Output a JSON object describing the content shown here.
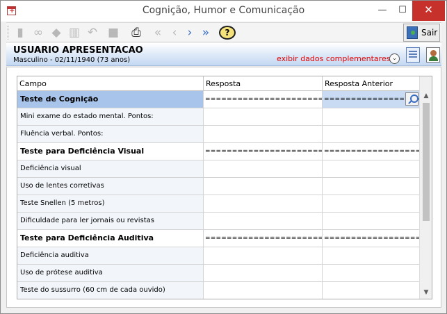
{
  "window": {
    "title": "Cognição, Humor e Comunicação",
    "minimize_glyph": "—",
    "maximize_glyph": "☐",
    "close_glyph": "✕"
  },
  "toolbar": {
    "help_label": "?",
    "exit_label": "Sair",
    "icons": [
      "new-icon",
      "binoculars-icon",
      "eraser-icon",
      "trash-icon",
      "undo-icon",
      "save-icon",
      "print-icon",
      "first-icon",
      "previous-icon",
      "next-icon",
      "last-icon",
      "help-icon",
      "exit-door-icon"
    ]
  },
  "patient": {
    "name": "USUARIO APRESENTACAO",
    "info": "Masculino - 02/11/1940 (73 anos)",
    "extra_link": "exibir dados complementares...",
    "expand_glyph": "⌄"
  },
  "grid": {
    "columns": [
      "Campo",
      "Resposta",
      "Resposta Anterior"
    ],
    "rows": [
      {
        "campo": "Teste de Cognição",
        "resposta": "================================",
        "anterior": "================================",
        "kind": "section",
        "selected": true
      },
      {
        "campo": "Mini exame do estado mental. Pontos:",
        "resposta": "",
        "anterior": "",
        "kind": "item"
      },
      {
        "campo": "Fluência verbal. Pontos:",
        "resposta": "",
        "anterior": "",
        "kind": "item"
      },
      {
        "campo": "Teste para Deficiência Visual",
        "resposta": "================================",
        "anterior": "================================",
        "kind": "section"
      },
      {
        "campo": "Deficiência visual",
        "resposta": "",
        "anterior": "",
        "kind": "item"
      },
      {
        "campo": "Uso de lentes corretivas",
        "resposta": "",
        "anterior": "",
        "kind": "item"
      },
      {
        "campo": "Teste Snellen (5 metros)",
        "resposta": "",
        "anterior": "",
        "kind": "item"
      },
      {
        "campo": "Dificuldade para ler jornais ou revistas",
        "resposta": "",
        "anterior": "",
        "kind": "item"
      },
      {
        "campo": "Teste para Deficiência Auditiva",
        "resposta": "================================",
        "anterior": "================================",
        "kind": "section"
      },
      {
        "campo": "Deficiência auditiva",
        "resposta": "",
        "anterior": "",
        "kind": "item"
      },
      {
        "campo": "Uso de prótese auditiva",
        "resposta": "",
        "anterior": "",
        "kind": "item"
      },
      {
        "campo": "Teste do sussurro (60 cm de cada ouvido)",
        "resposta": "",
        "anterior": "",
        "kind": "item"
      }
    ],
    "scroll_up_glyph": "▲",
    "scroll_down_glyph": "▼"
  },
  "colors": {
    "close_button": "#c7312b",
    "selected_row": "#a8c4ea",
    "extra_link": "#e00000",
    "nav_arrows": "#3a6fc4"
  }
}
